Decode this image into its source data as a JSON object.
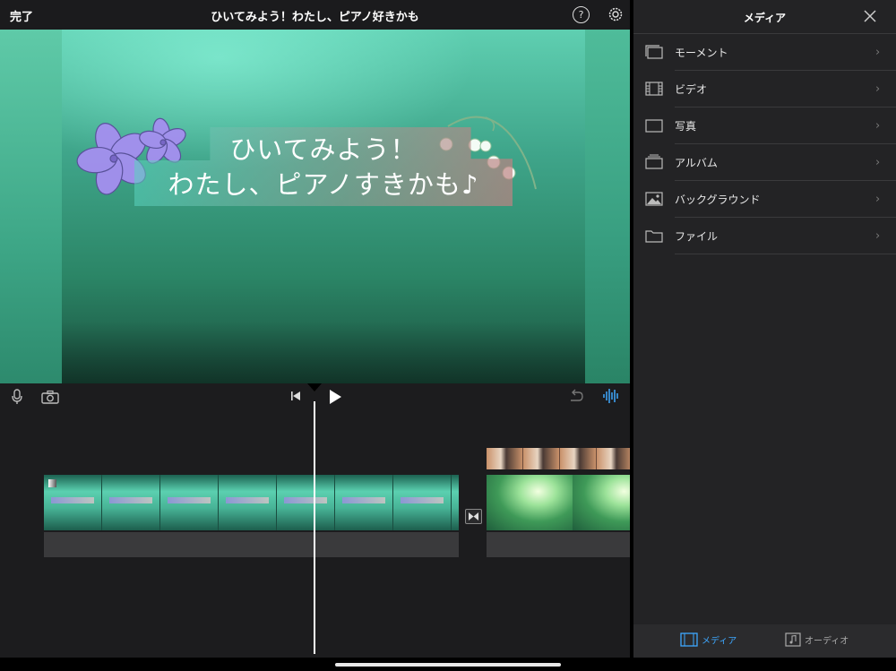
{
  "topbar": {
    "done_label": "完了",
    "project_title": "ひいてみよう！わたし、ピアノ好きかも"
  },
  "viewer": {
    "title_line_1": "ひいてみよう！",
    "title_line_2": "わたし、ピアノすきかも♪"
  },
  "media_panel": {
    "title": "メディア",
    "items": [
      {
        "label": "モーメント",
        "icon": "moments-icon"
      },
      {
        "label": "ビデオ",
        "icon": "film-icon"
      },
      {
        "label": "写真",
        "icon": "photo-icon"
      },
      {
        "label": "アルバム",
        "icon": "album-icon"
      },
      {
        "label": "バックグラウンド",
        "icon": "background-image-icon"
      },
      {
        "label": "ファイル",
        "icon": "folder-icon"
      }
    ],
    "tabs": {
      "media": "メディア",
      "audio": "オーディオ"
    }
  },
  "colors": {
    "accent": "#3ea8ff",
    "panel": "#232325",
    "timeline": "#1c1c1e"
  }
}
